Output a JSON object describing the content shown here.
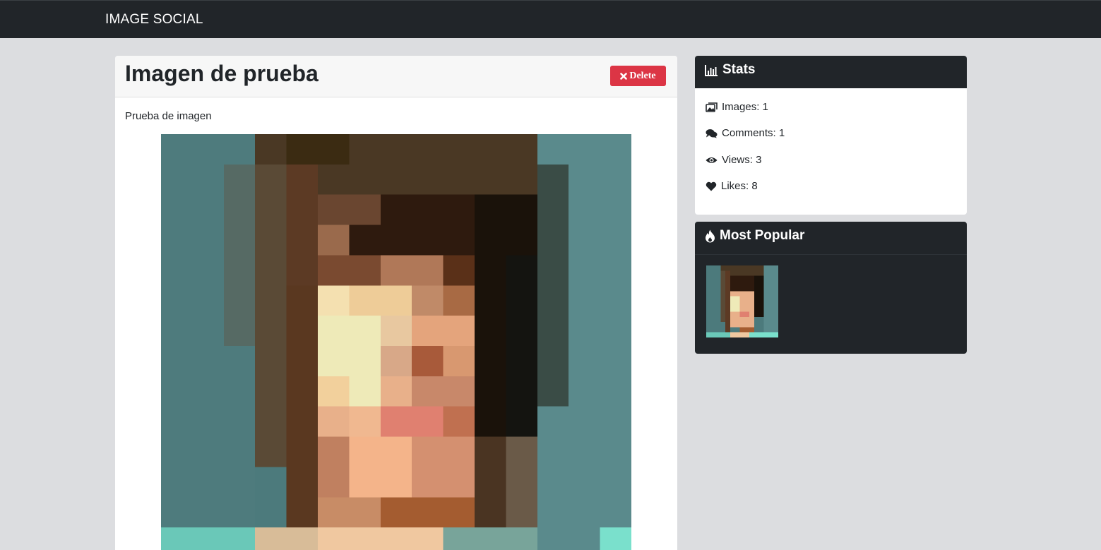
{
  "navbar": {
    "brand": "IMAGE SOCIAL"
  },
  "image_detail": {
    "title": "Imagen de prueba",
    "delete_label": "Delete",
    "description": "Prueba de imagen"
  },
  "stats": {
    "title": "Stats",
    "items": [
      {
        "icon": "images-icon",
        "label": "Images: 1"
      },
      {
        "icon": "comments-icon",
        "label": "Comments: 1"
      },
      {
        "icon": "eye-icon",
        "label": "Views: 3"
      },
      {
        "icon": "heart-icon",
        "label": "Likes: 8"
      }
    ]
  },
  "most_popular": {
    "title": "Most Popular"
  },
  "colors": {
    "navbar": "#212529",
    "page_background": "#dcdde0",
    "danger": "#dc3545",
    "card_header_light": "#f7f7f7"
  }
}
